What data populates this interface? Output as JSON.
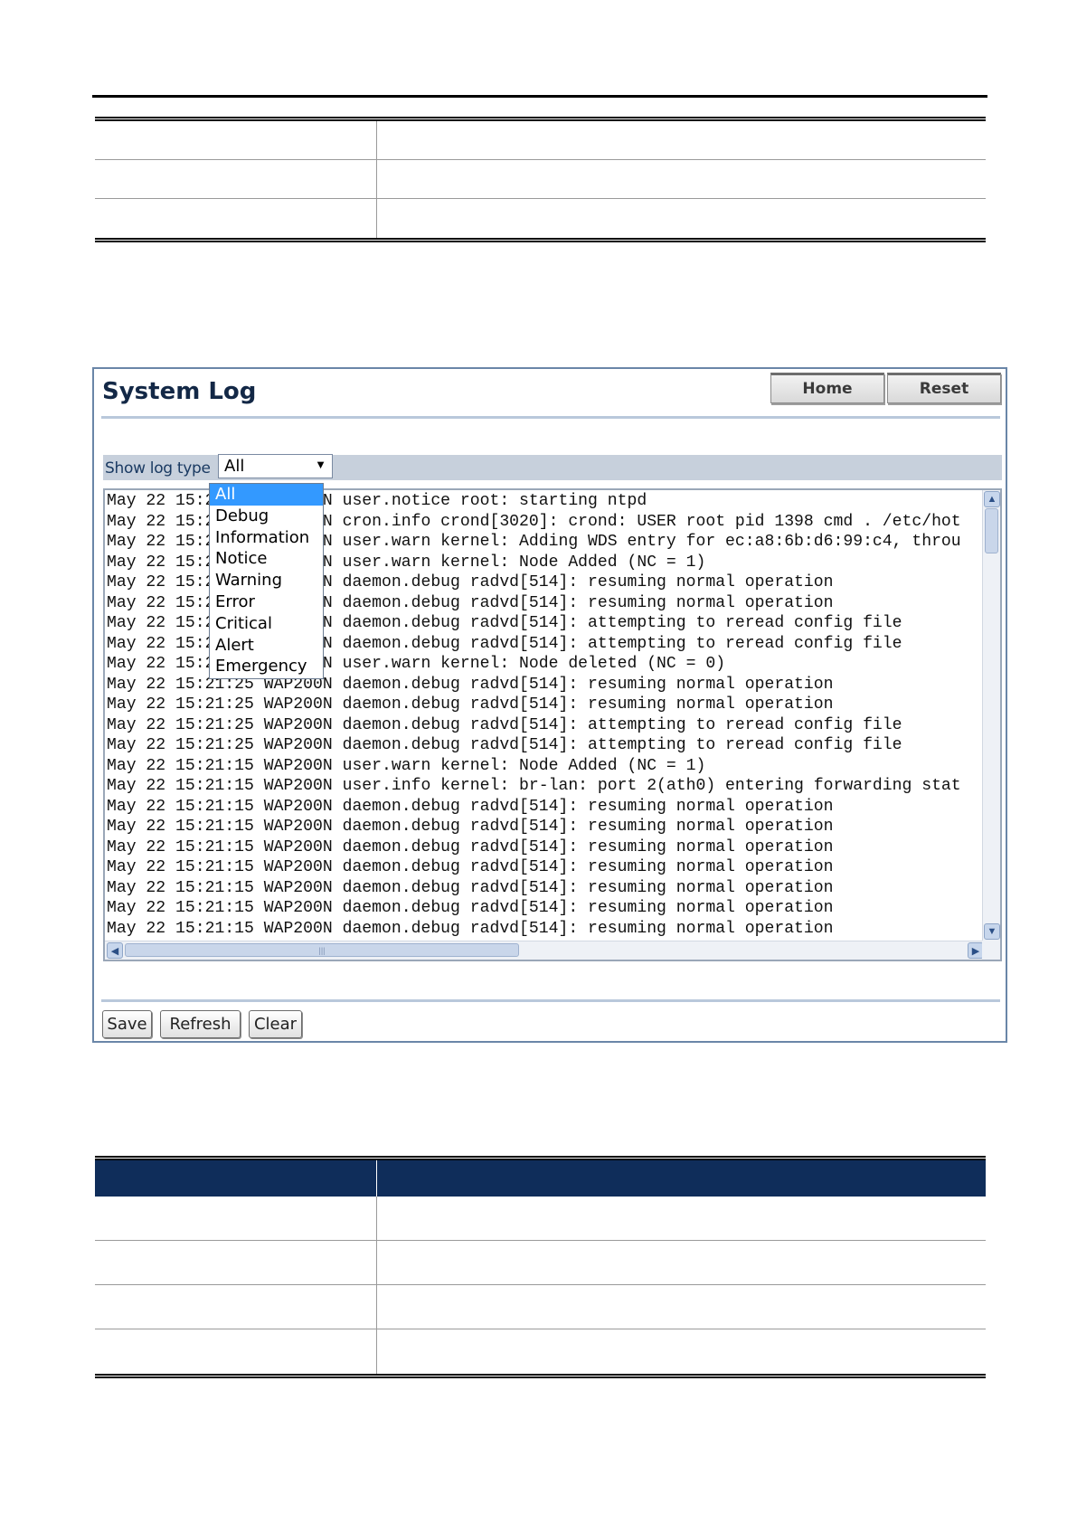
{
  "panel": {
    "title": "System Log",
    "home_label": "Home",
    "reset_label": "Reset",
    "filter_label": "Show log type",
    "selected_type": "All",
    "log_types": [
      "All",
      "Debug",
      "Information",
      "Notice",
      "Warning",
      "Error",
      "Critical",
      "Alert",
      "Emergency"
    ],
    "log_lines": [
      "May 22 15:21:25 WAP200N user.notice root: starting ntpd",
      "May 22 15:21:25 WAP200N cron.info crond[3020]: crond: USER root pid 1398 cmd . /etc/hot",
      "May 22 15:21:25 WAP200N user.warn kernel: Adding WDS entry for ec:a8:6b:d6:99:c4, throu",
      "May 22 15:21:25 WAP200N user.warn kernel: Node Added (NC = 1)",
      "May 22 15:21:25 WAP200N daemon.debug radvd[514]: resuming normal operation",
      "May 22 15:21:25 WAP200N daemon.debug radvd[514]: resuming normal operation",
      "May 22 15:21:25 WAP200N daemon.debug radvd[514]: attempting to reread config file",
      "May 22 15:21:25 WAP200N daemon.debug radvd[514]: attempting to reread config file",
      "May 22 15:21:25 WAP200N user.warn kernel: Node deleted (NC = 0)",
      "May 22 15:21:25 WAP200N daemon.debug radvd[514]: resuming normal operation",
      "May 22 15:21:25 WAP200N daemon.debug radvd[514]: resuming normal operation",
      "May 22 15:21:25 WAP200N daemon.debug radvd[514]: attempting to reread config file",
      "May 22 15:21:25 WAP200N daemon.debug radvd[514]: attempting to reread config file",
      "May 22 15:21:15 WAP200N user.warn kernel: Node Added (NC = 1)",
      "May 22 15:21:15 WAP200N user.info kernel: br-lan: port 2(ath0) entering forwarding stat",
      "May 22 15:21:15 WAP200N daemon.debug radvd[514]: resuming normal operation",
      "May 22 15:21:15 WAP200N daemon.debug radvd[514]: resuming normal operation",
      "May 22 15:21:15 WAP200N daemon.debug radvd[514]: resuming normal operation",
      "May 22 15:21:15 WAP200N daemon.debug radvd[514]: resuming normal operation",
      "May 22 15:21:15 WAP200N daemon.debug radvd[514]: resuming normal operation",
      "May 22 15:21:15 WAP200N daemon.debug radvd[514]: resuming normal operation",
      "May 22 15:21:15 WAP200N daemon.debug radvd[514]: resuming normal operation"
    ],
    "save_label": "Save",
    "refresh_label": "Refresh",
    "clear_label": "Clear"
  },
  "icons": {
    "dropdown_arrow": "triangle-down",
    "scroll_up": "chevron-up",
    "scroll_down": "chevron-down",
    "scroll_left": "chevron-left",
    "scroll_right": "chevron-right"
  },
  "colors": {
    "table_header": "#0f2d5a",
    "dropdown_selected": "#3399ff",
    "panel_title": "#132846"
  }
}
